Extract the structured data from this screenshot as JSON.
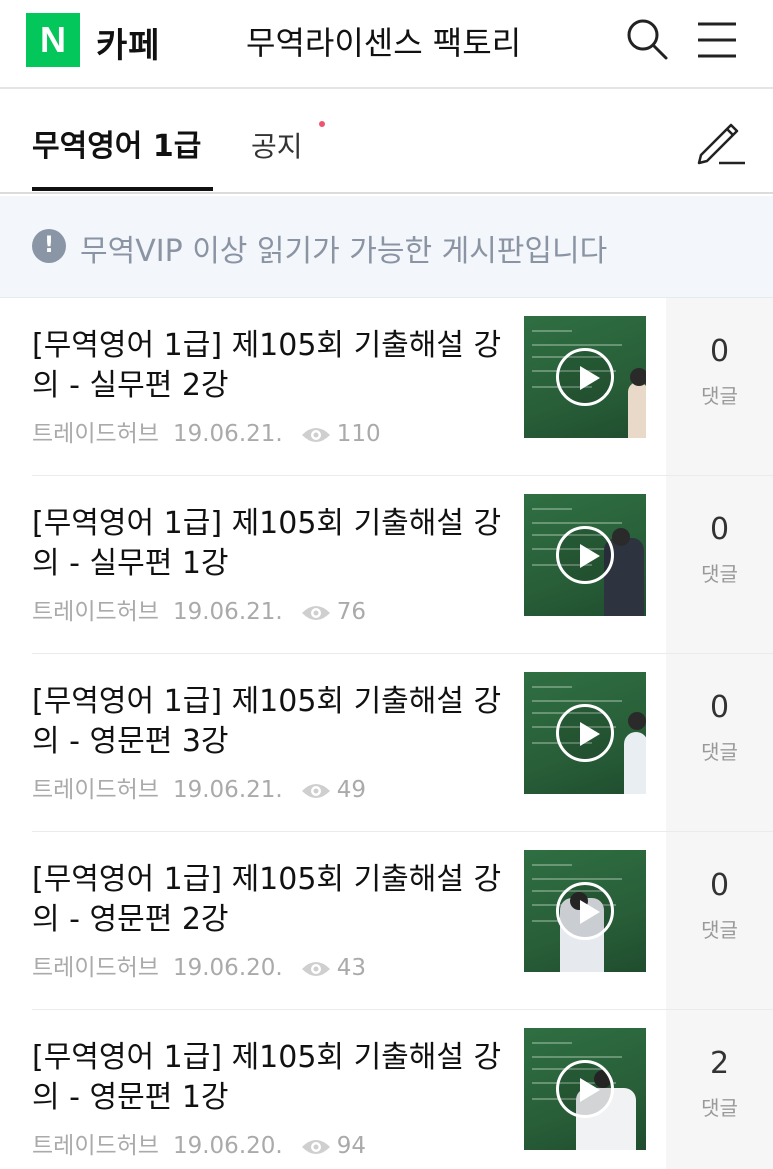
{
  "header": {
    "logo_letter": "N",
    "logo_text": "카페",
    "cafe_name": "무역라이센스 팩토리"
  },
  "tabs": {
    "active": "무역영어 1급",
    "notice": "공지"
  },
  "banner": {
    "icon": "!",
    "text": "무역VIP 이상 읽기가 가능한 게시판입니다"
  },
  "posts": [
    {
      "title": "[무역영어 1급] 제105회 기출해설 강의 - 실무편 2강",
      "author": "트레이드허브",
      "date": "19.06.21.",
      "views": "110",
      "comments": "0",
      "comment_label": "댓글"
    },
    {
      "title": "[무역영어 1급] 제105회 기출해설 강의 - 실무편 1강",
      "author": "트레이드허브",
      "date": "19.06.21.",
      "views": "76",
      "comments": "0",
      "comment_label": "댓글"
    },
    {
      "title": "[무역영어 1급] 제105회 기출해설 강의 - 영문편 3강",
      "author": "트레이드허브",
      "date": "19.06.21.",
      "views": "49",
      "comments": "0",
      "comment_label": "댓글"
    },
    {
      "title": "[무역영어 1급] 제105회 기출해설 강의 - 영문편 2강",
      "author": "트레이드허브",
      "date": "19.06.20.",
      "views": "43",
      "comments": "0",
      "comment_label": "댓글"
    },
    {
      "title": "[무역영어 1급] 제105회 기출해설 강의 - 영문편 1강",
      "author": "트레이드허브",
      "date": "19.06.20.",
      "views": "94",
      "comments": "2",
      "comment_label": "댓글"
    }
  ],
  "colors": {
    "brand": "#03c75a",
    "new_dot": "#f2526e",
    "banner_bg": "#f3f6fa"
  }
}
